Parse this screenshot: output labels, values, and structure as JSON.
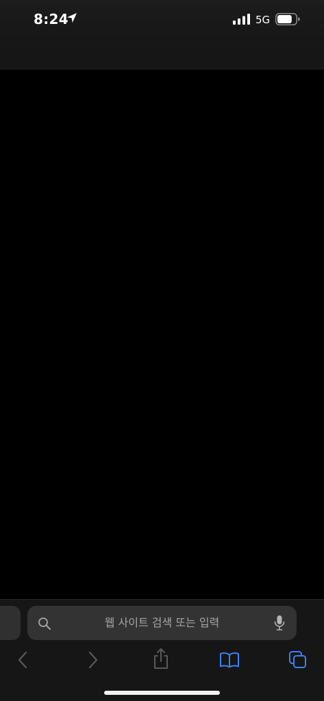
{
  "status_bar": {
    "time": "8:24",
    "network": "5G",
    "battery_level": 0.8
  },
  "address_bar": {
    "placeholder": "웹 사이트 검색 또는 입력"
  },
  "icons": {
    "location": "location-arrow-icon",
    "signal": "cellular-signal-icon",
    "battery": "battery-icon",
    "search": "magnifier-icon",
    "mic": "microphone-icon",
    "back": "chevron-left-icon",
    "forward": "chevron-right-icon",
    "share": "share-icon",
    "bookmarks": "book-icon",
    "tabs": "tabs-icon"
  },
  "colors": {
    "accent": "#3b82f6",
    "disabled": "#5a5a5a",
    "toolbar_bg": "#161616",
    "address_bg": "#333333"
  }
}
